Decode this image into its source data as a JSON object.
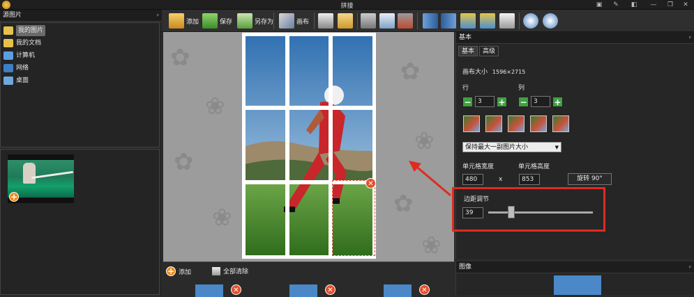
{
  "window": {
    "title": "拼接",
    "controls": [
      "▣",
      "✎",
      "◧",
      "—",
      "❐",
      "✕"
    ]
  },
  "left_panel": {
    "header": "源图片",
    "pin": "ᵖ",
    "tree": [
      {
        "label": "我的图片",
        "icon": "pictures-folder-icon",
        "selected": true
      },
      {
        "label": "我的文档",
        "icon": "documents-folder-icon",
        "selected": false
      },
      {
        "label": "计算机",
        "icon": "computer-icon",
        "selected": false
      },
      {
        "label": "网络",
        "icon": "network-icon",
        "selected": false
      },
      {
        "label": "桌面",
        "icon": "desktop-icon",
        "selected": false
      }
    ],
    "thumb_add": "+"
  },
  "toolbar": {
    "add_label": "添加",
    "save_label": "保存",
    "save_as_label": "另存为",
    "canvas_label": "画布"
  },
  "canvas": {
    "cell_close": "✕",
    "highlight_color": "#e02b20"
  },
  "bottom_strip": {
    "add_label": "添加",
    "clear_all_label": "全部清除",
    "thumb_close": "✕"
  },
  "right_panel": {
    "header": "基本",
    "pin": "ᵖ",
    "tabs": [
      "基本",
      "高级"
    ],
    "canvas_size_label": "画布大小",
    "canvas_size_value": "1596×2715",
    "rows_label": "行",
    "cols_label": "列",
    "rows_value": "3",
    "cols_value": "3",
    "minus": "−",
    "plus": "+",
    "fit_mode": "保持最大一副图片大小",
    "cell_width_label": "单元格宽度",
    "cell_height_label": "单元格高度",
    "cell_width_value": "480",
    "times": "x",
    "cell_height_value": "853",
    "rotate_label": "旋转 90°",
    "margin_label": "边距调节",
    "margin_value": "39",
    "margin_slider_fraction": 0.22
  },
  "image_panel": {
    "header": "图像",
    "pin": "ᵖ"
  }
}
